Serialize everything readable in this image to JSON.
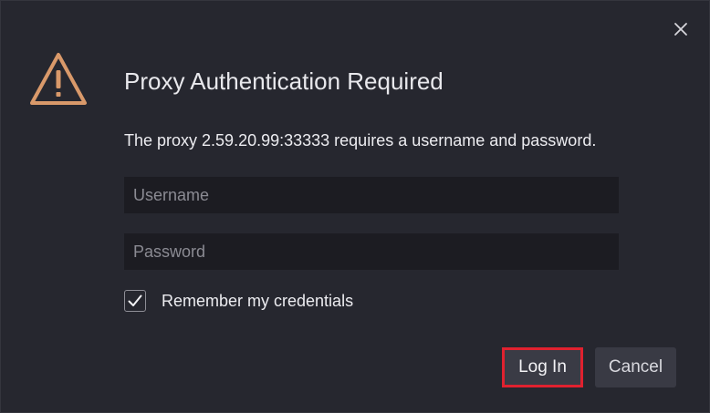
{
  "dialog": {
    "title": "Proxy Authentication Required",
    "message": "The proxy 2.59.20.99:33333 requires a username and password.",
    "close_icon": "close-icon",
    "warning_icon": "warning-triangle-icon",
    "warning_color": "#d9996a"
  },
  "form": {
    "username": {
      "value": "",
      "placeholder": "Username"
    },
    "password": {
      "value": "",
      "placeholder": "Password"
    },
    "remember": {
      "label": "Remember my credentials",
      "checked": true
    }
  },
  "buttons": {
    "login_label": "Log In",
    "cancel_label": "Cancel",
    "highlight_color": "#e0212f"
  }
}
